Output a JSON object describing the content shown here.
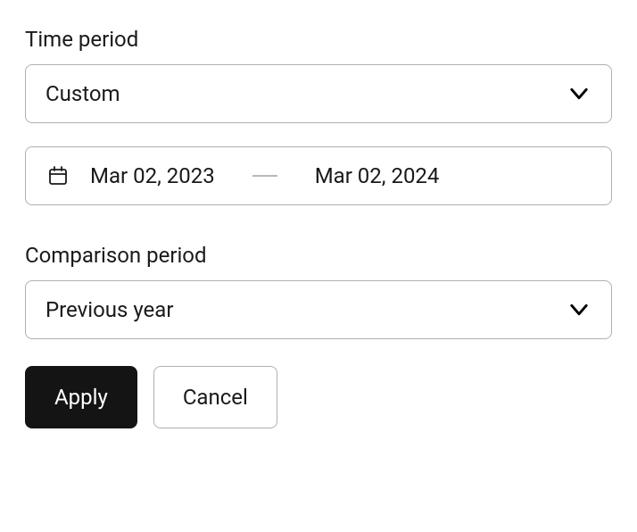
{
  "time_period": {
    "label": "Time period",
    "selected": "Custom"
  },
  "date_range": {
    "start": "Mar 02, 2023",
    "end": "Mar 02, 2024"
  },
  "comparison_period": {
    "label": "Comparison period",
    "selected": "Previous year"
  },
  "buttons": {
    "apply": "Apply",
    "cancel": "Cancel"
  }
}
